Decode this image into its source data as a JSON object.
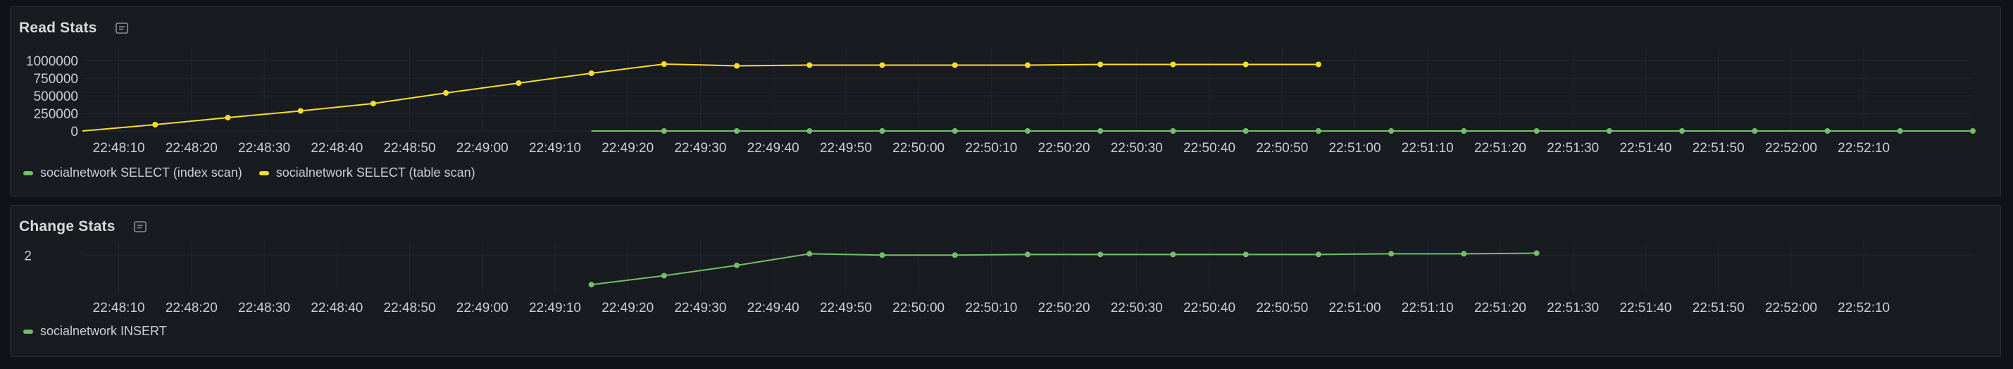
{
  "panels": [
    {
      "title": "Read Stats",
      "icon": "panel-info-icon"
    },
    {
      "title": "Change Stats",
      "icon": "panel-info-icon"
    }
  ],
  "colors": {
    "green": "#73bf69",
    "yellow": "#fade2a",
    "grid": "#24272e",
    "axis": "#ccccdc"
  },
  "chart_data": [
    {
      "type": "line",
      "title": "Read Stats",
      "x": [
        "22:48:05",
        "22:48:15",
        "22:48:25",
        "22:48:35",
        "22:48:45",
        "22:48:55",
        "22:49:05",
        "22:49:15",
        "22:49:25",
        "22:49:35",
        "22:49:45",
        "22:49:55",
        "22:50:05",
        "22:50:15",
        "22:50:25",
        "22:50:35",
        "22:50:45",
        "22:50:55",
        "22:51:05",
        "22:51:15",
        "22:51:25",
        "22:51:35",
        "22:51:45",
        "22:51:55",
        "22:52:05",
        "22:52:15",
        "22:52:25"
      ],
      "xticks": [
        "22:48:10",
        "22:48:20",
        "22:48:30",
        "22:48:40",
        "22:48:50",
        "22:49:00",
        "22:49:10",
        "22:49:20",
        "22:49:30",
        "22:49:40",
        "22:49:50",
        "22:50:00",
        "22:50:10",
        "22:50:20",
        "22:50:30",
        "22:50:40",
        "22:50:50",
        "22:51:00",
        "22:51:10",
        "22:51:20",
        "22:51:30",
        "22:51:40",
        "22:51:50",
        "22:52:00",
        "22:52:10"
      ],
      "yticks": [
        "0",
        "250000",
        "500000",
        "750000",
        "1000000"
      ],
      "ylim": [
        0,
        1000000
      ],
      "series": [
        {
          "name": "socialnetwork SELECT (index scan)",
          "color": "#73bf69",
          "points": [
            [
              "22:49:15",
              0
            ],
            [
              "22:49:25",
              0
            ],
            [
              "22:49:35",
              0
            ],
            [
              "22:49:45",
              0
            ],
            [
              "22:49:55",
              0
            ],
            [
              "22:50:05",
              0
            ],
            [
              "22:50:15",
              0
            ],
            [
              "22:50:25",
              0
            ],
            [
              "22:50:35",
              0
            ],
            [
              "22:50:45",
              0
            ],
            [
              "22:50:55",
              0
            ],
            [
              "22:51:05",
              0
            ],
            [
              "22:51:15",
              0
            ],
            [
              "22:51:25",
              0
            ],
            [
              "22:51:35",
              0
            ],
            [
              "22:51:45",
              0
            ],
            [
              "22:51:55",
              0
            ],
            [
              "22:52:05",
              0
            ],
            [
              "22:52:15",
              0
            ],
            [
              "22:52:25",
              0
            ]
          ]
        },
        {
          "name": "socialnetwork SELECT (table scan)",
          "color": "#fade2a",
          "points": [
            [
              "22:48:05",
              0
            ],
            [
              "22:48:15",
              90000
            ],
            [
              "22:48:25",
              190000
            ],
            [
              "22:48:35",
              285000
            ],
            [
              "22:48:45",
              390000
            ],
            [
              "22:48:55",
              540000
            ],
            [
              "22:49:05",
              680000
            ],
            [
              "22:49:15",
              820000
            ],
            [
              "22:49:25",
              950000
            ],
            [
              "22:49:35",
              925000
            ],
            [
              "22:49:45",
              935000
            ],
            [
              "22:49:55",
              935000
            ],
            [
              "22:50:05",
              935000
            ],
            [
              "22:50:15",
              935000
            ],
            [
              "22:50:25",
              945000
            ],
            [
              "22:50:35",
              945000
            ],
            [
              "22:50:45",
              945000
            ],
            [
              "22:50:55",
              945000
            ]
          ]
        }
      ]
    },
    {
      "type": "line",
      "title": "Change Stats",
      "xticks": [
        "22:48:10",
        "22:48:20",
        "22:48:30",
        "22:48:40",
        "22:48:50",
        "22:49:00",
        "22:49:10",
        "22:49:20",
        "22:49:30",
        "22:49:40",
        "22:49:50",
        "22:50:00",
        "22:50:10",
        "22:50:20",
        "22:50:30",
        "22:50:40",
        "22:50:50",
        "22:51:00",
        "22:51:10",
        "22:51:20",
        "22:51:30",
        "22:51:40",
        "22:51:50",
        "22:52:00",
        "22:52:10"
      ],
      "yticks": [
        "2"
      ],
      "ylim": [
        1.7,
        2.1
      ],
      "series": [
        {
          "name": "socialnetwork INSERT",
          "color": "#73bf69",
          "points": [
            [
              "22:49:15",
              1.77
            ],
            [
              "22:49:25",
              1.84
            ],
            [
              "22:49:35",
              1.92
            ],
            [
              "22:49:45",
              2.01
            ],
            [
              "22:49:55",
              2.0
            ],
            [
              "22:50:05",
              2.0
            ],
            [
              "22:50:15",
              2.005
            ],
            [
              "22:50:25",
              2.005
            ],
            [
              "22:50:35",
              2.005
            ],
            [
              "22:50:45",
              2.005
            ],
            [
              "22:50:55",
              2.005
            ],
            [
              "22:51:05",
              2.01
            ],
            [
              "22:51:15",
              2.01
            ],
            [
              "22:51:25",
              2.015
            ]
          ]
        }
      ]
    }
  ]
}
